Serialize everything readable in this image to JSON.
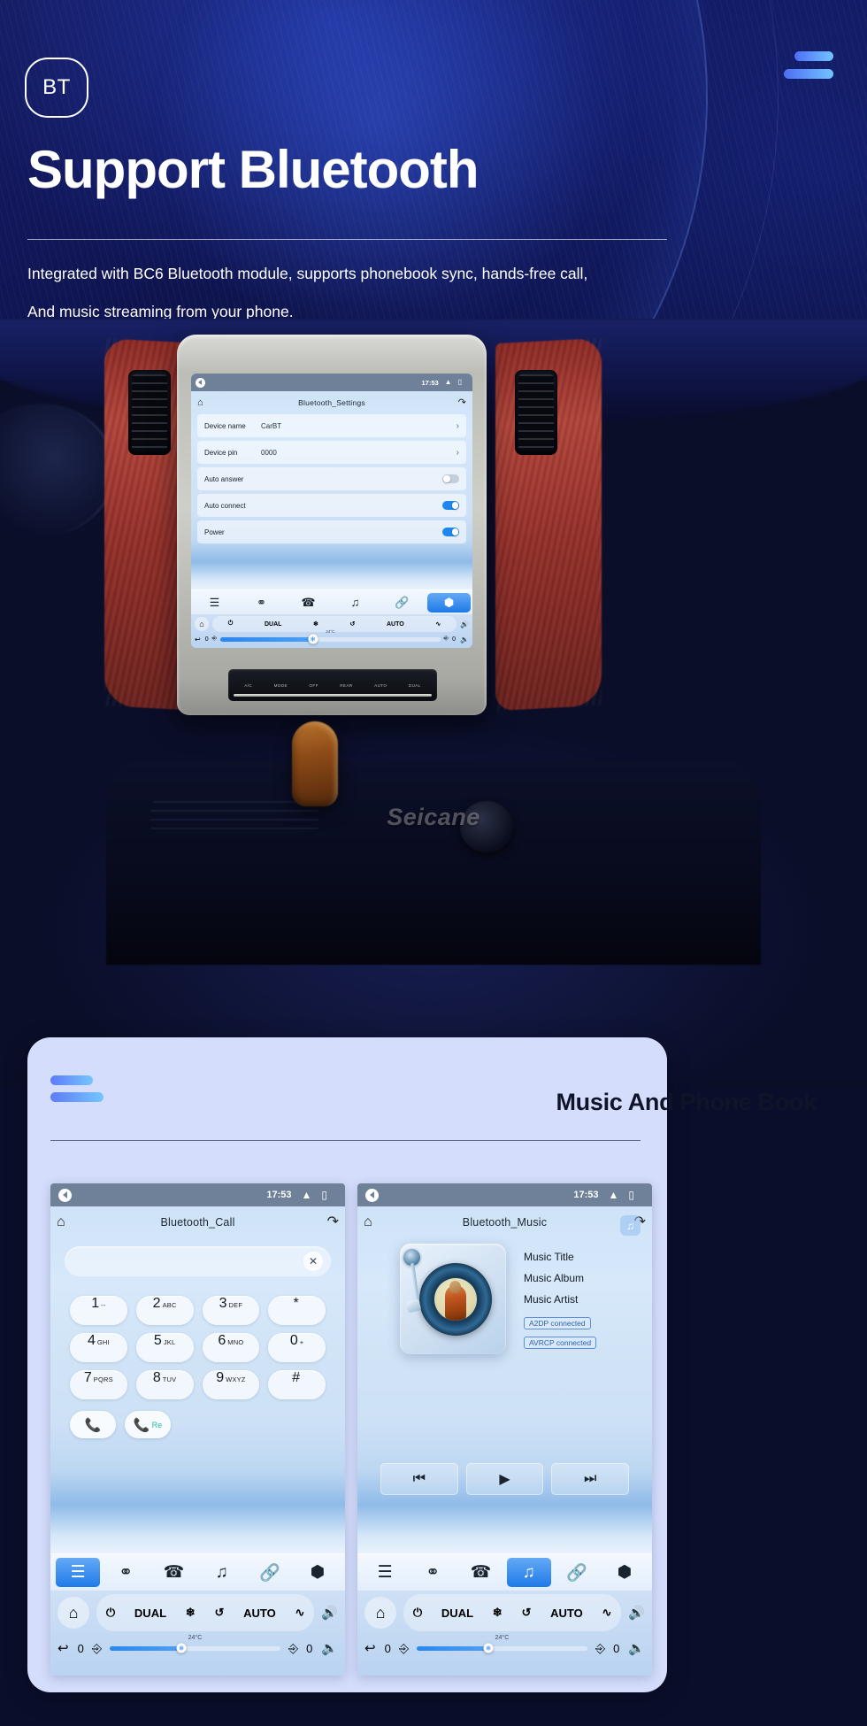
{
  "hero": {
    "badge": "BT",
    "title": "Support Bluetooth",
    "subtitle_line1": "Integrated with BC6 Bluetooth module, supports phonebook sync, hands-free call,",
    "subtitle_line2": "And music streaming from your phone.",
    "accent_color": "#5f7bf7",
    "accent_color_2": "#74c6ff",
    "background_color": "#11175a"
  },
  "photo": {
    "watermark": "Seicane",
    "ac_panel_buttons": [
      "A/C",
      "MODE",
      "OFF",
      "REAR",
      "AUTO",
      "DUAL"
    ]
  },
  "settings_screen": {
    "status": {
      "time": "17:53",
      "up_icon": "chevron-up",
      "window_icon": "recent-apps"
    },
    "title": "Bluetooth_Settings",
    "home_icon": "home-icon",
    "back_icon": "undo-icon",
    "rows": [
      {
        "label": "Device name",
        "value": "CarBT",
        "type": "chevron"
      },
      {
        "label": "Device pin",
        "value": "0000",
        "type": "chevron"
      },
      {
        "label": "Auto answer",
        "value": "",
        "type": "toggle",
        "state": "off"
      },
      {
        "label": "Auto connect",
        "value": "",
        "type": "toggle",
        "state": "on"
      },
      {
        "label": "Power",
        "value": "",
        "type": "toggle",
        "state": "on"
      }
    ],
    "nav": [
      {
        "name": "dialpad-icon",
        "active": false
      },
      {
        "name": "contacts-icon",
        "active": false
      },
      {
        "name": "phone-icon",
        "active": false
      },
      {
        "name": "music-icon",
        "active": false
      },
      {
        "name": "link-icon",
        "active": false
      },
      {
        "name": "settings-icon",
        "active": true
      }
    ],
    "climate": {
      "power": "power-icon",
      "dual": "DUAL",
      "snow": "snowflake-icon",
      "recirc": "recirculate-icon",
      "auto": "AUTO",
      "defrost": "defrost-icon",
      "vol_up": "volume-up-icon",
      "vol_down": "volume-down-icon",
      "back": "back-arrow-icon",
      "home": "home-icon",
      "left_level": "0",
      "right_level": "0",
      "temperature": "24°C",
      "seat_icon": "seat-icon",
      "seat_heat_icon": "seat-heat-icon",
      "fan_icon": "fan-icon"
    }
  },
  "card": {
    "title": "Music And Phone Book",
    "background_color": "#d4ddfb"
  },
  "call_screen": {
    "status": {
      "time": "17:53",
      "up_icon": "chevron-up",
      "window_icon": "recent-apps"
    },
    "title": "Bluetooth_Call",
    "home_icon": "home-icon",
    "back_icon": "undo-icon",
    "input_value": "",
    "clear_icon": "close-icon",
    "keys": [
      {
        "digit": "1",
        "sub": "--"
      },
      {
        "digit": "2",
        "sub": "ABC"
      },
      {
        "digit": "3",
        "sub": "DEF"
      },
      {
        "digit": "*",
        "sub": ""
      },
      {
        "digit": "4",
        "sub": "GHI"
      },
      {
        "digit": "5",
        "sub": "JKL"
      },
      {
        "digit": "6",
        "sub": "MNO"
      },
      {
        "digit": "0",
        "sub": "+"
      },
      {
        "digit": "7",
        "sub": "PQRS"
      },
      {
        "digit": "8",
        "sub": "TUV"
      },
      {
        "digit": "9",
        "sub": "WXYZ"
      },
      {
        "digit": "#",
        "sub": ""
      }
    ],
    "call_button": "call-icon",
    "redial_button_label": "Re",
    "nav": [
      {
        "name": "dialpad-icon",
        "active": true
      },
      {
        "name": "contacts-icon",
        "active": false
      },
      {
        "name": "phone-icon",
        "active": false
      },
      {
        "name": "music-icon",
        "active": false
      },
      {
        "name": "link-icon",
        "active": false
      },
      {
        "name": "settings-icon",
        "active": false
      }
    ],
    "climate": {
      "dual": "DUAL",
      "auto": "AUTO",
      "left_level": "0",
      "right_level": "0",
      "temperature": "24°C"
    }
  },
  "music_screen": {
    "status": {
      "time": "17:53",
      "up_icon": "chevron-up",
      "window_icon": "recent-apps"
    },
    "title": "Bluetooth_Music",
    "home_icon": "home-icon",
    "back_icon": "undo-icon",
    "badge_icon": "music-note-icon",
    "album_art": "turntable-vinyl",
    "track_title": "Music Title",
    "track_album": "Music Album",
    "track_artist": "Music Artist",
    "chip_a2dp": "A2DP  connected",
    "chip_avrcp": "AVRCP connected",
    "controls": [
      "prev-icon",
      "play-icon",
      "next-icon"
    ],
    "nav": [
      {
        "name": "dialpad-icon",
        "active": false
      },
      {
        "name": "contacts-icon",
        "active": false
      },
      {
        "name": "phone-icon",
        "active": false
      },
      {
        "name": "music-icon",
        "active": true
      },
      {
        "name": "link-icon",
        "active": false
      },
      {
        "name": "settings-icon",
        "active": false
      }
    ],
    "climate": {
      "dual": "DUAL",
      "auto": "AUTO",
      "left_level": "0",
      "right_level": "0",
      "temperature": "24°C"
    }
  }
}
